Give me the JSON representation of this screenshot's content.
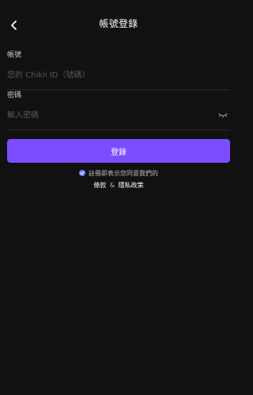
{
  "header": {
    "title": "帳號登錄",
    "back_icon": "chevron-left-icon"
  },
  "account": {
    "label": "帳號",
    "placeholder": "您的 Chikii ID（號碼）",
    "value": ""
  },
  "password": {
    "label": "密碼",
    "placeholder": "輸入密碼",
    "value": "",
    "toggle_icon": "eye-closed-icon"
  },
  "login_button": {
    "label": "登錄"
  },
  "agreement": {
    "checked": true,
    "text": "註冊即表示您同意我們的",
    "terms_label": "條款",
    "separator": "&",
    "privacy_label": "隱私政策"
  },
  "colors": {
    "background": "#111111",
    "accent": "#7c4dff",
    "check": "#6b7cff",
    "placeholder": "#595959",
    "divider": "#2a2a2a"
  }
}
